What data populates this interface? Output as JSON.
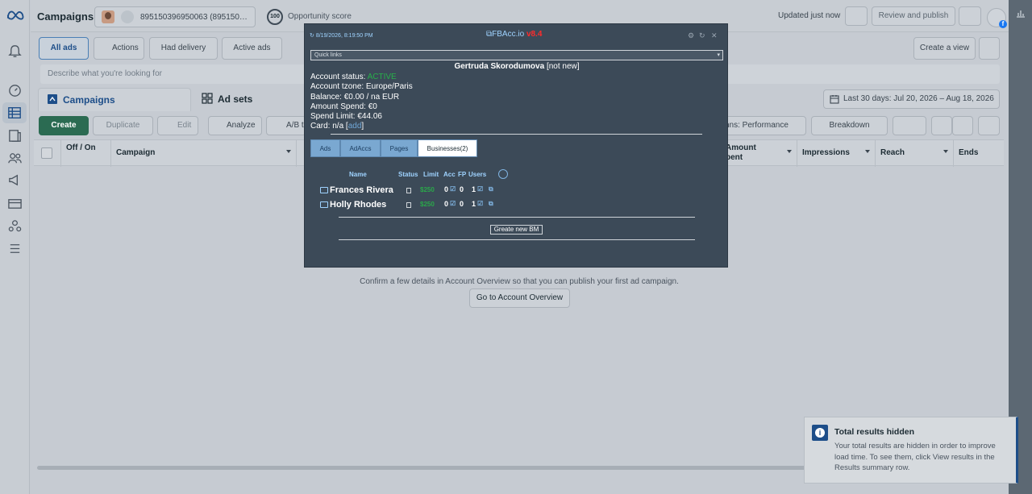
{
  "header": {
    "title": "Campaigns",
    "account_id": "895150396950063 (895150…",
    "opportunity_score": "100",
    "opportunity_label": "Opportunity score",
    "updated": "Updated just now",
    "review_publish": "Review and publish"
  },
  "filters": {
    "all_ads": "All ads",
    "actions": "Actions",
    "had_delivery": "Had delivery",
    "active_ads": "Active ads",
    "create_view": "Create a view"
  },
  "search": {
    "placeholder": "Describe what you're looking for"
  },
  "tabs": {
    "campaigns": "Campaigns",
    "ad_sets": "Ad sets"
  },
  "date_range": "Last 30 days: Jul 20, 2026 – Aug 18, 2026",
  "toolbar": {
    "create": "Create",
    "duplicate": "Duplicate",
    "edit": "Edit",
    "analyze": "Analyze",
    "ab": "A/B t",
    "columns": "nns: Performance",
    "breakdown": "Breakdown"
  },
  "table": {
    "headers": {
      "off_on": "Off / On",
      "campaign": "Campaign",
      "amount_spent": "Amount\npent",
      "impressions": "Impressions",
      "reach": "Reach",
      "ends": "Ends"
    }
  },
  "empty": {
    "text": "Confirm a few details in Account Overview so that you can publish your first ad campaign.",
    "button": "Go to Account Overview"
  },
  "fbacc": {
    "timestamp": "8/19/2026, 8:19:50 PM",
    "brand": "FBAcc.io",
    "version": "v8.4",
    "quick_links": "Quick links",
    "person_name": "Gertruda Skorodumova",
    "person_status": "[not new]",
    "account_status_label": "Account status:",
    "account_status_value": "ACTIVE",
    "tzone": "Account tzone: Europe/Paris",
    "balance": "Balance: €0.00 / na EUR",
    "amount_spend": "Amount Spend:  €0",
    "spend_limit": "Spend Limit: €44.06",
    "card_prefix": "Card: n/a [",
    "card_link": "add",
    "card_suffix": "]",
    "tabs": [
      "Ads",
      "AdAccs",
      "Pages",
      "Businesses(2)"
    ],
    "columns": [
      "Name",
      "Status",
      "Limit",
      "Acc",
      "FP",
      "Users"
    ],
    "businesses": [
      {
        "name": "Frances Rivera",
        "limit": "$250",
        "acc": "0",
        "fp": "0",
        "users": "1"
      },
      {
        "name": "Holly Rhodes",
        "limit": "$250",
        "acc": "0",
        "fp": "0",
        "users": "1"
      }
    ],
    "create_bm": "Greate new BM"
  },
  "toast": {
    "title": "Total results hidden",
    "body": "Your total results are hidden in order to improve load time. To see them, click View results in the Results summary row."
  }
}
